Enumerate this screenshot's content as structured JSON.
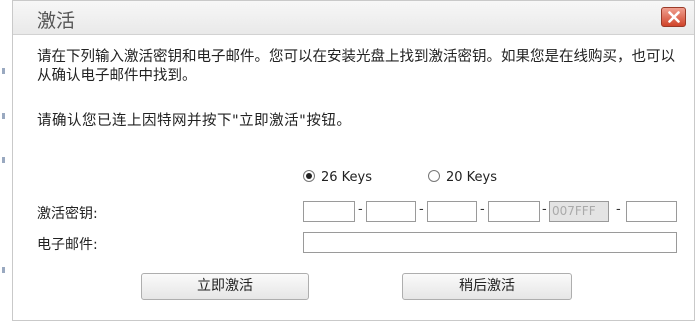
{
  "dialog": {
    "title": "激活",
    "close_icon": "close-icon",
    "description": "请在下列输入激活密钥和电子邮件。您可以在安装光盘上找到激活密钥。如果您是在线购买，也可以从确认电子邮件中找到。",
    "instruction": "请确认您已连上因特网并按下\"立即激活\"按钮。",
    "key_type_options": [
      {
        "label": "26 Keys",
        "selected": true
      },
      {
        "label": "20 Keys",
        "selected": false
      }
    ],
    "key_label": "激活密钥:",
    "key_fields": [
      {
        "value": ""
      },
      {
        "value": ""
      },
      {
        "value": ""
      },
      {
        "value": ""
      },
      {
        "value": "007FFF"
      },
      {
        "value": ""
      }
    ],
    "key_separator": "-",
    "email_label": "电子邮件:",
    "email_value": "",
    "activate_now_label": "立即激活",
    "activate_later_label": "稍后激活"
  },
  "colors": {
    "close_button": "#d0442a",
    "disabled_field_bg": "#e4e4e4",
    "disabled_field_text": "#aaaaaa"
  }
}
